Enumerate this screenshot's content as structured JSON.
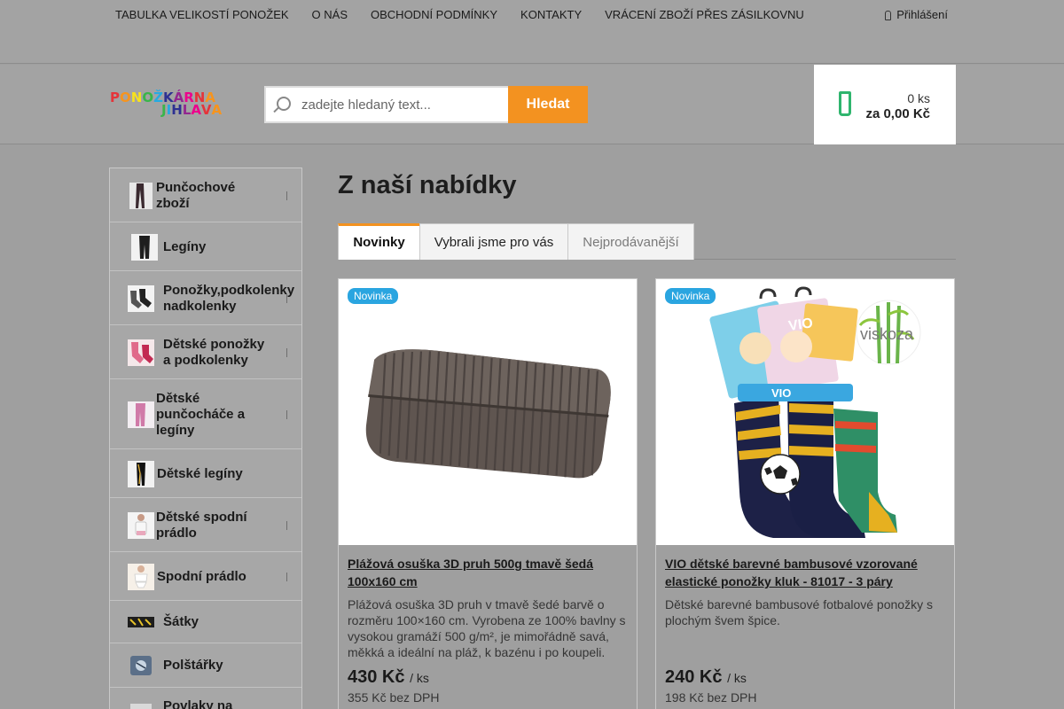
{
  "topnav": {
    "links": [
      "TABULKA VELIKOSTÍ PONOŽEK",
      "O NÁS",
      "OBCHODNÍ PODMÍNKY",
      "KONTAKTY",
      "VRÁCENÍ ZBOŽÍ PŘES ZÁSILKOVNU"
    ],
    "login": "Přihlášení"
  },
  "logo": {
    "line1": [
      "P",
      "O",
      "N",
      "O",
      "Ž",
      "K",
      "Á",
      "R",
      "N",
      "A"
    ],
    "line2": [
      "J",
      "I",
      "H",
      "L",
      "A",
      "V",
      "A"
    ],
    "colors": [
      "#e5343a",
      "#f7941d",
      "#f7e11d",
      "#39b54a",
      "#27aae1",
      "#2e3192",
      "#92278f",
      "#ec008c",
      "#e5343a",
      "#f7941d"
    ]
  },
  "search": {
    "placeholder": "zadejte hledaný text...",
    "button": "Hledat"
  },
  "cart": {
    "qty": "0 ks",
    "total": "za 0,00 Kč",
    "accent": "#2fb56e"
  },
  "sidebar": {
    "items": [
      {
        "label": "Punčochové zboží",
        "arrow": true
      },
      {
        "label": "Legíny",
        "arrow": false
      },
      {
        "label": "Ponožky,podkolenky nadkolenky",
        "arrow": true
      },
      {
        "label": "Dětské ponožky a podkolenky",
        "arrow": true
      },
      {
        "label": "Dětské punčocháče a legíny",
        "arrow": true
      },
      {
        "label": "Dětské legíny",
        "arrow": false
      },
      {
        "label": "Dětské spodní prádlo",
        "arrow": true
      },
      {
        "label": "Spodní prádlo",
        "arrow": true
      },
      {
        "label": "Šátky",
        "arrow": false
      },
      {
        "label": "Polštářky",
        "arrow": false
      },
      {
        "label": "Povlaky na",
        "arrow": false
      }
    ]
  },
  "main": {
    "title": "Z naší nabídky",
    "tabs": [
      "Novinky",
      "Vybrali jsme pro vás",
      "Nejprodávanější"
    ],
    "products": [
      {
        "badge": "Novinka",
        "name": "Plážová osuška 3D pruh 500g tmavě šedá 100x160 cm",
        "desc": "Plážová osuška 3D pruh v tmavě šedé barvě o rozměru 100×160 cm. Vyrobena ze 100% bavlny s vysokou gramáží 500 g/m², je mimořádně savá, měkká a ideální na pláž, k bazénu i po koupeli.",
        "price": "430 Kč",
        "unit": "/ ks",
        "net": "355 Kč bez DPH"
      },
      {
        "badge": "Novinka",
        "name": "VIO dětské barevné bambusové vzorované elastické ponožky kluk - 81017 - 3 páry",
        "desc": "Dětské barevné bambusové fotbalové ponožky s plochým švem špice.",
        "price": "240 Kč",
        "unit": "/ ks",
        "net": "198 Kč bez DPH",
        "logo_text": "viskoza"
      }
    ]
  },
  "colors": {
    "accent": "#f39220",
    "badge": "#2aa5e0"
  }
}
